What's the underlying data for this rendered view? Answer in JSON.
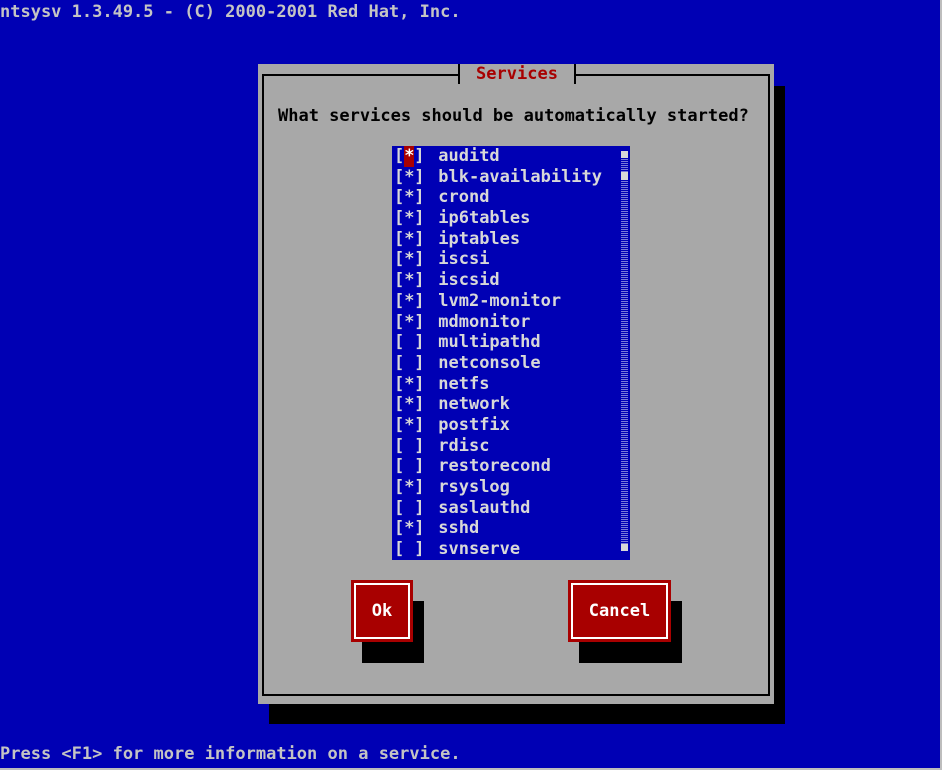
{
  "header": {
    "title": "ntsysv 1.3.49.5 - (C) 2000-2001 Red Hat, Inc."
  },
  "dialog": {
    "title": "Services",
    "prompt": "What services should be automatically started?",
    "services": [
      {
        "mark": "*",
        "name": "auditd"
      },
      {
        "mark": "*",
        "name": "blk-availability"
      },
      {
        "mark": "*",
        "name": "crond"
      },
      {
        "mark": "*",
        "name": "ip6tables"
      },
      {
        "mark": "*",
        "name": "iptables"
      },
      {
        "mark": "*",
        "name": "iscsi"
      },
      {
        "mark": "*",
        "name": "iscsid"
      },
      {
        "mark": "*",
        "name": "lvm2-monitor"
      },
      {
        "mark": "*",
        "name": "mdmonitor"
      },
      {
        "mark": " ",
        "name": "multipathd"
      },
      {
        "mark": " ",
        "name": "netconsole"
      },
      {
        "mark": "*",
        "name": "netfs"
      },
      {
        "mark": "*",
        "name": "network"
      },
      {
        "mark": "*",
        "name": "postfix"
      },
      {
        "mark": " ",
        "name": "rdisc"
      },
      {
        "mark": " ",
        "name": "restorecond"
      },
      {
        "mark": "*",
        "name": "rsyslog"
      },
      {
        "mark": " ",
        "name": "saslauthd"
      },
      {
        "mark": "*",
        "name": "sshd"
      },
      {
        "mark": " ",
        "name": "svnserve"
      }
    ],
    "ok_label": "Ok",
    "cancel_label": "Cancel"
  },
  "footer": {
    "hint": "Press <F1> for more information on a service."
  },
  "colors": {
    "screen": "#0000b4",
    "dialog": "#a8a8a8",
    "accent": "#a80000",
    "text": "#c4c4c4"
  }
}
